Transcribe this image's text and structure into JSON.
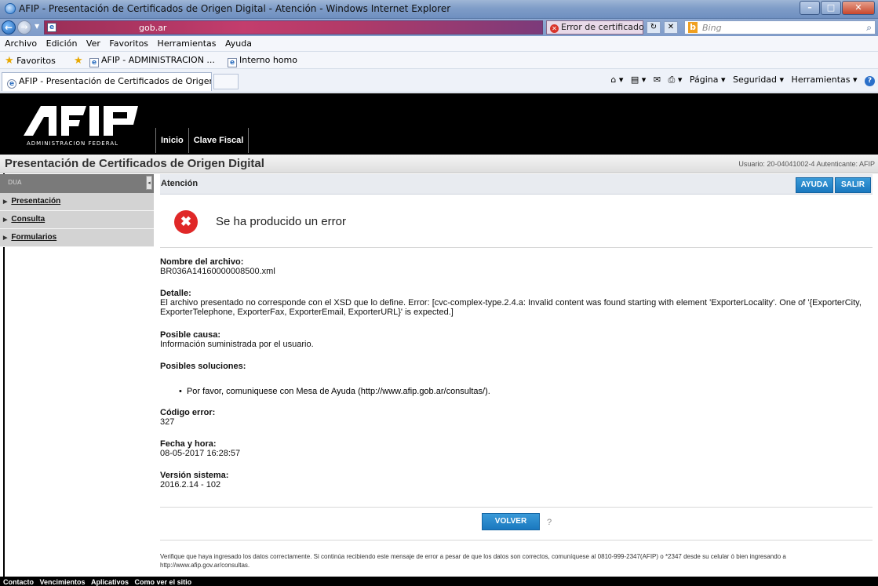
{
  "window": {
    "title": "AFIP - Presentación de Certificados de Origen Digital - Atención - Windows Internet Explorer"
  },
  "address_bar": {
    "url_visible": "gob.ar",
    "cert_error": "Error de certificado",
    "search_placeholder": "Bing"
  },
  "menu": [
    "Archivo",
    "Edición",
    "Ver",
    "Favoritos",
    "Herramientas",
    "Ayuda"
  ],
  "favorites_bar": {
    "favorites_label": "Favoritos",
    "item1": "AFIP - ADMINISTRACION ...",
    "item2": "Interno homo"
  },
  "tab": {
    "label": "AFIP - Presentación de Certificados de Origen Di..."
  },
  "command_bar": {
    "pagina": "Página ▾",
    "seguridad": "Seguridad ▾",
    "herramientas": "Herramientas ▾"
  },
  "header": {
    "logo_subtitle": "ADMINISTRACION FEDERAL",
    "nav": [
      "Inicio",
      "Clave Fiscal"
    ]
  },
  "page": {
    "title": "Presentación de Certificados de Origen Digital",
    "user_info": "Usuario: 20-04041002-4 Autenticante: AFIP"
  },
  "sidebar": {
    "header": "DUA",
    "items": [
      "Presentación",
      "Consulta",
      "Formularios"
    ]
  },
  "content": {
    "heading": "Atención",
    "btn_ayuda": "AYUDA",
    "btn_salir": "SALIR",
    "error_title": "Se ha producido un error",
    "file_label": "Nombre del archivo:",
    "file_value": "BR036A14160000008500.xml",
    "detail_label": "Detalle:",
    "detail_value": "El archivo presentado no corresponde con el XSD que lo define. Error: [cvc-complex-type.2.4.a: Invalid content was found starting with element 'ExporterLocality'. One of '{ExporterCity, ExporterTelephone, ExporterFax, ExporterEmail, ExporterURL}' is expected.]",
    "cause_label": "Posible causa:",
    "cause_value": "Información suministrada por el usuario.",
    "solutions_label": "Posibles soluciones:",
    "solution_1": "Por favor, comuniquese con Mesa de Ayuda (http://www.afip.gob.ar/consultas/).",
    "code_label": "Código error:",
    "code_value": "327",
    "date_label": "Fecha y hora:",
    "date_value": "08-05-2017 16:28:57",
    "version_label": "Versión sistema:",
    "version_value": "2016.2.14 - 102",
    "btn_volver": "VOLVER",
    "help_mark": "?",
    "footnote": "Verifique que haya ingresado los datos correctamente. Si continúa recibiendo este mensaje de error a pesar de que los datos son correctos, comuníquese al 0810-999-2347(AFIP) o *2347 desde su celular ó bien ingresando a http://www.afip.gov.ar/consultas."
  },
  "footer": [
    "Contacto",
    "Vencimientos",
    "Aplicativos",
    "Como ver el sitio"
  ]
}
